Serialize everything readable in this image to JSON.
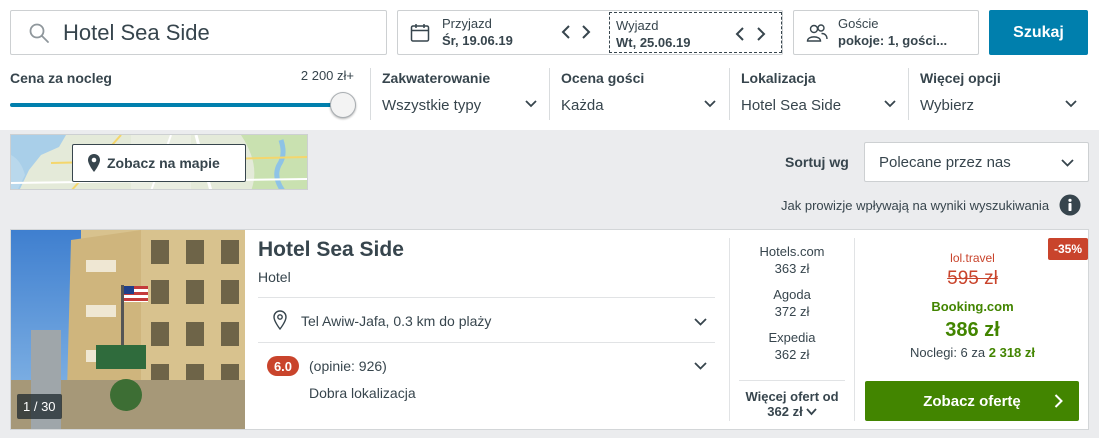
{
  "search": {
    "value": "Hotel Sea Side"
  },
  "dates": {
    "checkin_label": "Przyjazd",
    "checkin_value": "Śr, 19.06.19",
    "checkout_label": "Wyjazd",
    "checkout_value": "Wt, 25.06.19"
  },
  "guests": {
    "label": "Goście",
    "value": "pokoje: 1, gości..."
  },
  "search_button": "Szukaj",
  "filters": {
    "price_label": "Cena za nocleg",
    "price_max": "2 200 zł+",
    "price_slider_fraction": 1.0,
    "items": [
      {
        "label": "Zakwaterowanie",
        "value": "Wszystkie typy"
      },
      {
        "label": "Ocena gości",
        "value": "Każda"
      },
      {
        "label": "Lokalizacja",
        "value": "Hotel Sea Side"
      },
      {
        "label": "Więcej opcji",
        "value": "Wybierz"
      }
    ]
  },
  "map_button": "Zobacz na mapie",
  "sort": {
    "label": "Sortuj wg",
    "value": "Polecane przez nas"
  },
  "commission_info": "Jak prowizje wpływają na wyniki wyszukiwania",
  "hotel": {
    "photo_count": "1 / 30",
    "name": "Hotel Sea Side",
    "type": "Hotel",
    "location": "Tel Awiw-Jafa, 0.3 km do plaży",
    "rating": "6.0",
    "reviews": "(opinie: 926)",
    "rating_text": "Dobra lokalizacja",
    "partners": [
      {
        "name": "Hotels.com",
        "price": "363 zł"
      },
      {
        "name": "Agoda",
        "price": "372 zł"
      },
      {
        "name": "Expedia",
        "price": "362 zł"
      }
    ],
    "more_offers_label": "Więcej ofert od",
    "more_offers_price": "362 zł",
    "discount": "-35%",
    "old_source": "lol.travel",
    "old_price": "595 zł",
    "best_source": "Booking.com",
    "best_price": "386 zł",
    "nights_prefix": "Noclegi: 6 za",
    "nights_total": "2 318 zł",
    "offer_button": "Zobacz ofertę"
  },
  "colors": {
    "accent_blue": "#007fad",
    "deal_green": "#428500",
    "alert_red": "#c9442c",
    "text": "#37454d"
  }
}
